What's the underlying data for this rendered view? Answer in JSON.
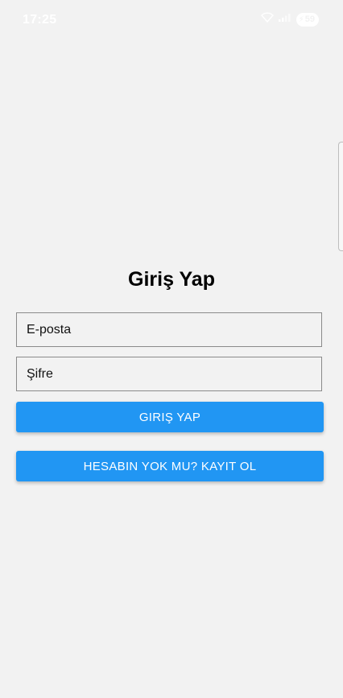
{
  "status_bar": {
    "time": "17:25",
    "battery_level": "59",
    "icons": [
      "wifi-icon",
      "signal-icon",
      "battery-icon"
    ]
  },
  "login": {
    "title": "Giriş Yap",
    "email_placeholder": "E-posta",
    "password_placeholder": "Şifre",
    "login_button": "GIRIŞ YAP",
    "register_button": "HESABIN YOK MU? KAYIT OL"
  },
  "colors": {
    "background": "#f2f2f2",
    "primary": "#2196f3",
    "button_text": "#ffffff"
  }
}
